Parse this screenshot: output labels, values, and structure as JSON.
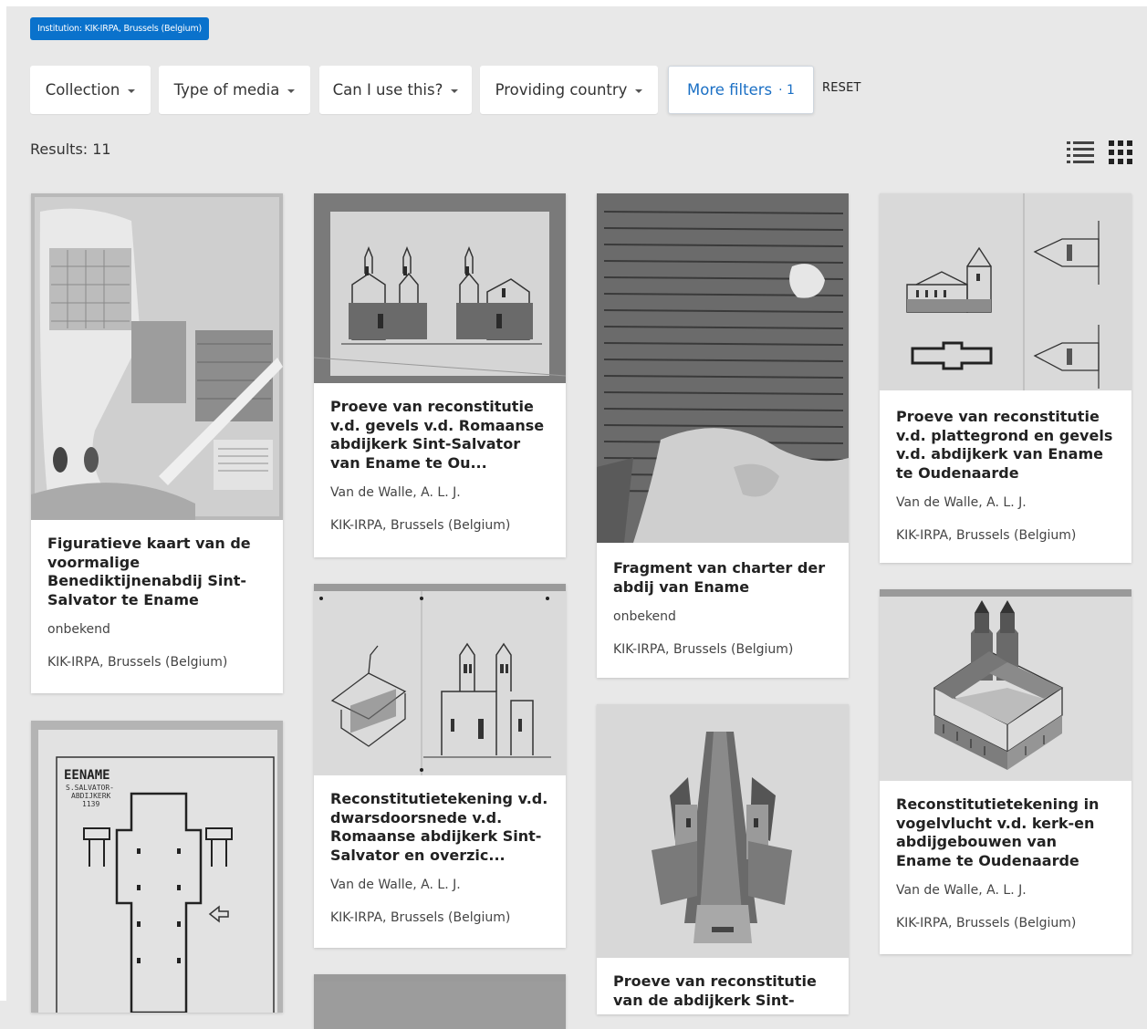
{
  "chip": {
    "label": "Institution: KIK-IRPA, Brussels (Belgium)"
  },
  "filters": [
    {
      "label": "Collection"
    },
    {
      "label": "Type of media"
    },
    {
      "label": "Can I use this?"
    },
    {
      "label": "Providing country"
    }
  ],
  "more_filters": {
    "label": "More filters",
    "count": "· 1"
  },
  "reset_label": "RESET",
  "results_label": "Results: 11",
  "view_icons": [
    "list-view-icon",
    "grid-view-icon"
  ],
  "colors": {
    "accent": "#0a72cc",
    "background": "#e8e8e8",
    "card": "#ffffff"
  },
  "cards": [
    {
      "title": "Figuratieve kaart van de voormalige Benediktijnenabdij Sint-Salvator te Ename",
      "creator": "onbekend",
      "institution": "KIK-IRPA, Brussels (Belgium)"
    },
    {
      "title": "Proeve van reconstitutie v.d. gevels v.d. Romaanse abdijkerk Sint-Salvator van Ename te Ou...",
      "creator": "Van de Walle, A. L. J.",
      "institution": "KIK-IRPA, Brussels (Belgium)"
    },
    {
      "title": "Fragment van charter der abdij van Ename",
      "creator": "onbekend",
      "institution": "KIK-IRPA, Brussels (Belgium)"
    },
    {
      "title": "Proeve van reconstitutie v.d. plattegrond en gevels v.d. abdijkerk van Ename te Oudenaarde",
      "creator": "Van de Walle, A. L. J.",
      "institution": "KIK-IRPA, Brussels (Belgium)"
    },
    {
      "title": "Reconstitutietekening v.d. dwarsdoorsnede v.d. Romaanse abdijkerk Sint-Salvator en overzic...",
      "creator": "Van de Walle, A. L. J.",
      "institution": "KIK-IRPA, Brussels (Belgium)"
    },
    {
      "title": "Reconstitutietekening in vogelvlucht v.d. kerk-en abdijgebouwen van Ename te Oudenaarde",
      "creator": "Van de Walle, A. L. J.",
      "institution": "KIK-IRPA, Brussels (Belgium)"
    },
    {
      "title": "Proeve van reconstitutie van de abdijkerk Sint-"
    }
  ],
  "plan_image_text": {
    "line1": "EENAME",
    "line2": "S.SALVATOR-",
    "line3": "ABDIJKERK",
    "line4": "1139"
  }
}
